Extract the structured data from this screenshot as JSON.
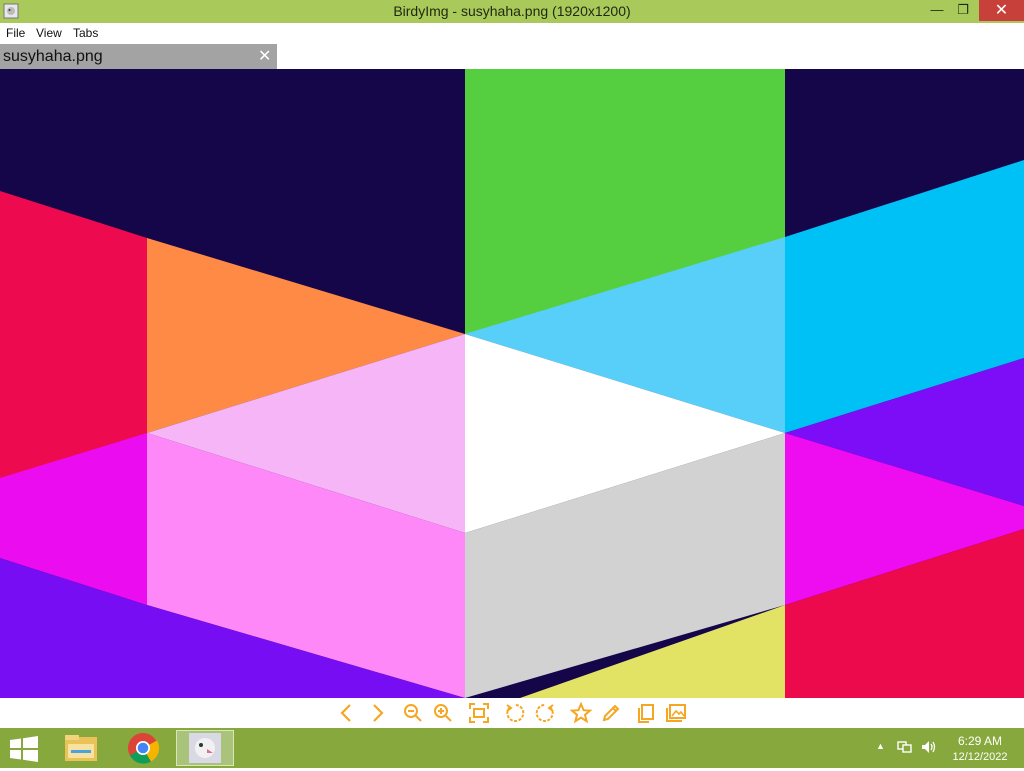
{
  "window": {
    "title": "BirdyImg - susyhaha.png (1920x1200)",
    "minimize_label": "—",
    "restore_label": "❐",
    "close_label": "✕"
  },
  "menu": {
    "items": [
      "File",
      "View",
      "Tabs"
    ]
  },
  "tabs": [
    {
      "label": "susyhaha.png",
      "close_label": "✕"
    }
  ],
  "image": {
    "filename": "susyhaha.png",
    "width": 1920,
    "height": 1200
  },
  "toolbar": {
    "accent": "#f5a623",
    "buttons": [
      "prev-icon",
      "next-icon",
      "zoom-out-icon",
      "zoom-in-icon",
      "fit-icon",
      "rotate-left-icon",
      "rotate-right-icon",
      "favorite-icon",
      "edit-icon",
      "copy-icon",
      "gallery-icon"
    ]
  },
  "taskbar": {
    "color": "#87a83c",
    "apps": [
      "file-explorer-icon",
      "chrome-icon",
      "birdyimg-icon"
    ],
    "time": "6:29 AM",
    "date": "12/12/2022"
  }
}
